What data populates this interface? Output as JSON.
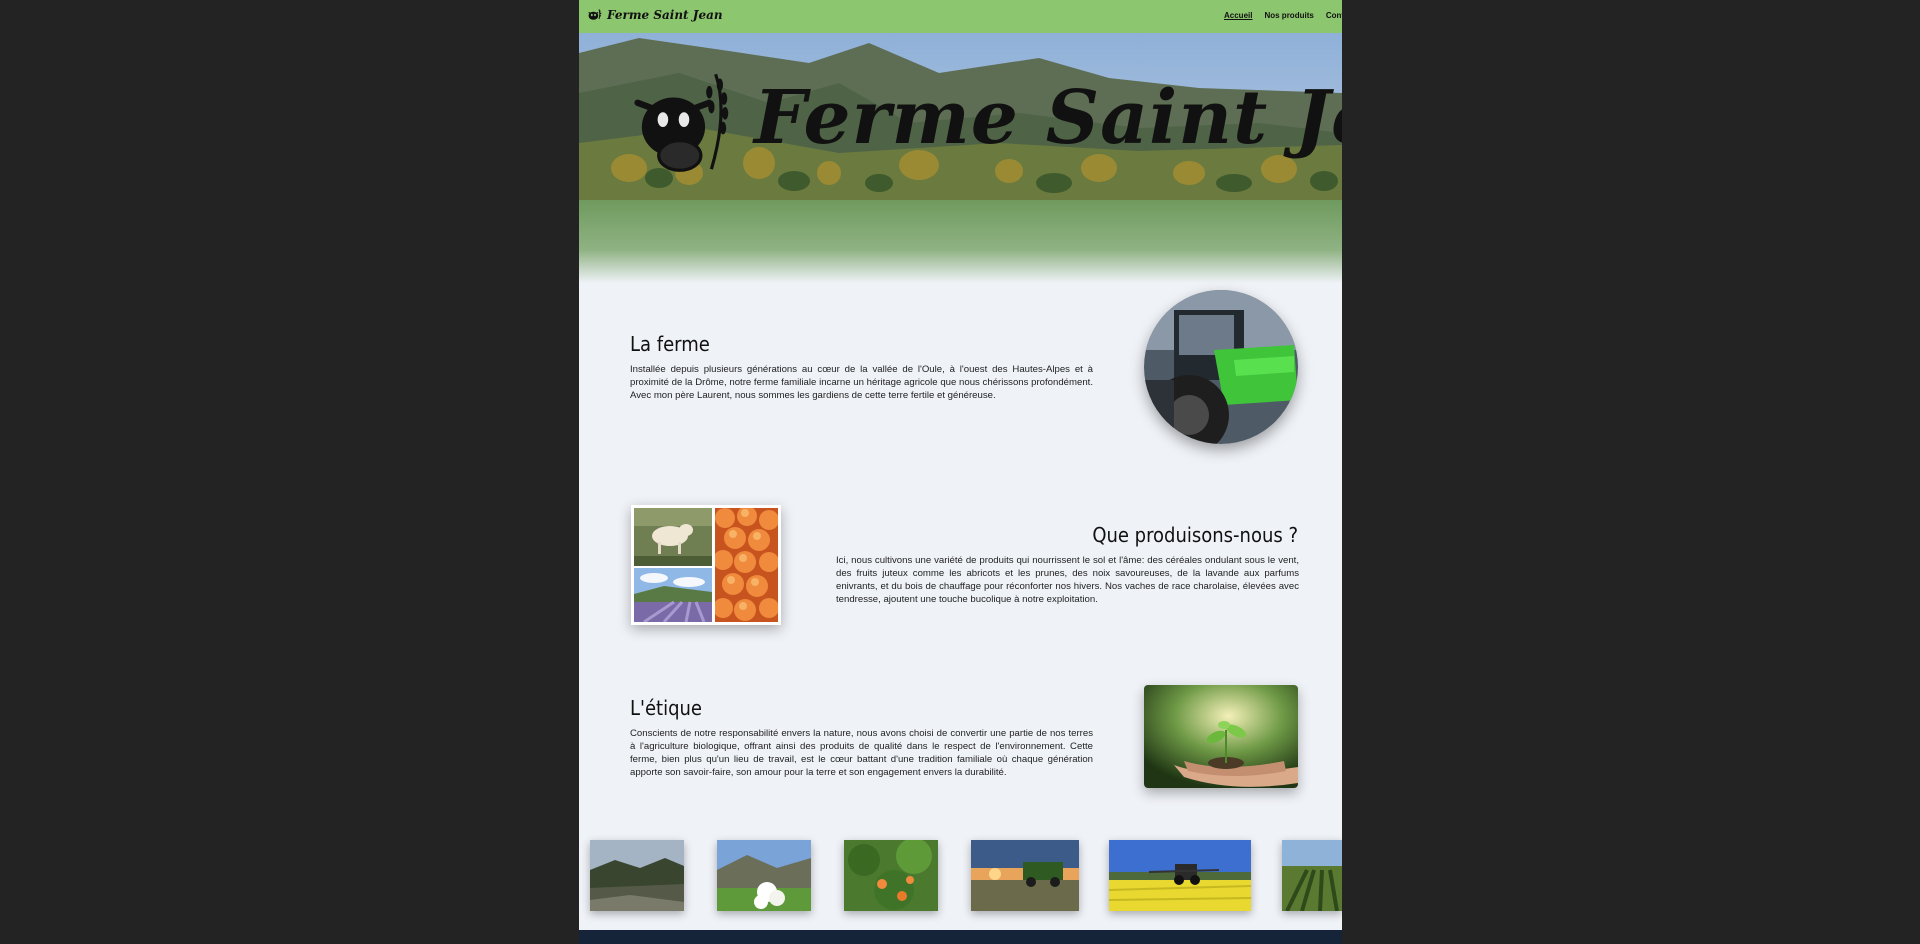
{
  "nav": {
    "brand": "Ferme Saint Jean",
    "links": [
      "Accueil",
      "Nos produits",
      "Contact"
    ]
  },
  "hero": {
    "title": "Ferme Saint Jean"
  },
  "sections": [
    {
      "title": "La ferme",
      "text": "Installée depuis plusieurs générations au cœur de la vallée de l'Oule, à l'ouest des Hautes-Alpes et à proximité de la Drôme, notre ferme familiale incarne un héritage agricole que nous chérissons profondément. Avec mon père Laurent, nous sommes les gardiens de cette terre fertile et généreuse."
    },
    {
      "title": "Que produisons-nous ?",
      "text": "Ici, nous cultivons une variété de produits qui nourrissent le sol et l'âme: des céréales ondulant sous le vent, des fruits juteux comme les abricots et les prunes, des noix savoureuses, de la lavande aux parfums enivrants, et du bois de chauffage pour réconforter nos hivers. Nos vaches de race charolaise, élevées avec tendresse, ajoutent une touche bucolique à notre exploitation."
    },
    {
      "title": "L'étique",
      "text": "Conscients de notre responsabilité envers la nature, nous avons choisi de convertir une partie de nos terres à l'agriculture biologique, offrant ainsi des produits de qualité dans le respect de l'environnement. Cette ferme, bien plus qu'un lieu de travail, est le cœur battant d'une tradition familiale où chaque génération apporte son savoir-faire, son amour pour la terre et son engagement envers la durabilité."
    }
  ],
  "colors": {
    "nav_bg": "#8cc66e",
    "page_bg": "#eff2f7",
    "footer_bg": "#16243a",
    "outer_bg": "#232323"
  },
  "icons": {
    "brand": "cow-wheat-logo-icon"
  }
}
